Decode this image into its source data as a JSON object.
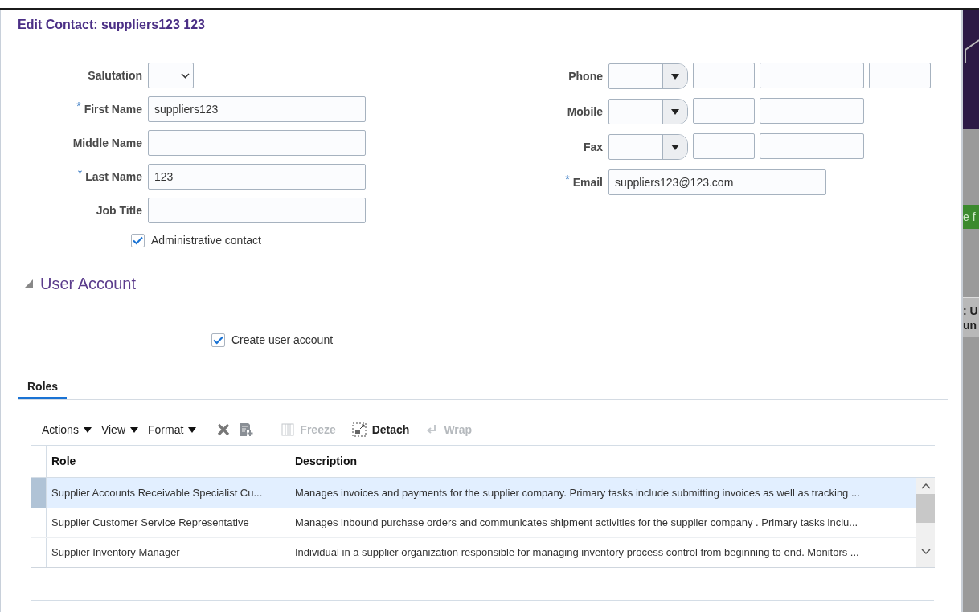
{
  "dialog": {
    "title": "Edit Contact: suppliers123 123"
  },
  "left_fields": [
    {
      "label": "Salutation",
      "required": false,
      "kind": "select"
    },
    {
      "label": "First Name",
      "required": true,
      "kind": "text",
      "value": "suppliers123"
    },
    {
      "label": "Middle Name",
      "required": false,
      "kind": "text"
    },
    {
      "label": "Last Name",
      "required": true,
      "kind": "text",
      "value": "123"
    },
    {
      "label": "Job Title",
      "required": false,
      "kind": "text"
    }
  ],
  "admin_checkbox": {
    "label": "Administrative contact",
    "checked": true
  },
  "required_mark": "*",
  "right_fields": [
    {
      "label": "Phone",
      "required": false,
      "kind": "phone",
      "extension": true
    },
    {
      "label": "Mobile",
      "required": false,
      "kind": "phone",
      "extension": false
    },
    {
      "label": "Fax",
      "required": false,
      "kind": "phone",
      "extension": false
    },
    {
      "label": "Email",
      "required": true,
      "kind": "text",
      "value": "suppliers123@123.com"
    }
  ],
  "section": {
    "title": "User Account",
    "expanded": true
  },
  "user_checkbox": {
    "label": "Create user account",
    "checked": true
  },
  "tabs": [
    {
      "label": "Roles",
      "selected": true
    }
  ],
  "toolbar": [
    {
      "kind": "menu",
      "label": "Actions",
      "disabled": false
    },
    {
      "kind": "menu",
      "label": "View",
      "disabled": false
    },
    {
      "kind": "menu",
      "label": "Format",
      "disabled": false
    },
    {
      "kind": "delete",
      "disabled": false
    },
    {
      "kind": "add",
      "disabled": false
    },
    {
      "kind": "freeze",
      "label": "Freeze",
      "disabled": true
    },
    {
      "kind": "detach",
      "label": "Detach",
      "disabled": false
    },
    {
      "kind": "wrap",
      "label": "Wrap",
      "disabled": true
    }
  ],
  "table": {
    "columns": [
      "Role",
      "Description"
    ],
    "rows": [
      {
        "selected": true,
        "cells": [
          "Supplier Accounts Receivable Specialist Cu...",
          "Manages invoices and payments for the supplier company. Primary tasks include submitting invoices as well as tracking ..."
        ]
      },
      {
        "selected": false,
        "cells": [
          "Supplier Customer Service Representative",
          "Manages inbound purchase orders and communicates shipment activities for the supplier company . Primary tasks inclu..."
        ]
      },
      {
        "selected": false,
        "cells": [
          "Supplier Inventory Manager",
          "Individual in a supplier organization responsible for managing inventory process control from beginning to end. Monitors ..."
        ]
      }
    ]
  },
  "background": {
    "button_fragment": "e f",
    "text_fragments": [
      ": U",
      "un"
    ]
  }
}
